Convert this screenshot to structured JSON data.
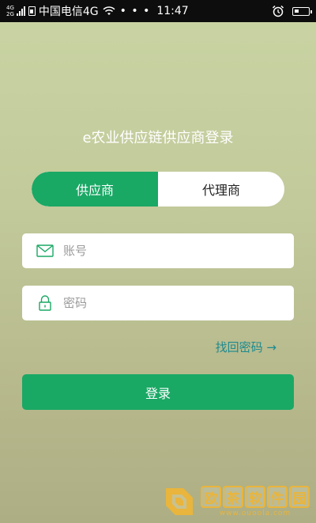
{
  "status_bar": {
    "sig_top": "4G",
    "sig_bottom": "2G",
    "carrier": "中国电信4G",
    "dots": "• • •",
    "time": "11:47"
  },
  "login": {
    "title": "e农业供应链供应商登录",
    "tabs": [
      {
        "label": "供应商",
        "active": true
      },
      {
        "label": "代理商",
        "active": false
      }
    ],
    "account_placeholder": "账号",
    "password_placeholder": "密码",
    "forgot_password": "找回密码 →",
    "submit_label": "登录"
  },
  "watermark": {
    "chars": [
      "欧",
      "茶",
      "软",
      "件",
      "园"
    ],
    "url": "www.ouoola.com"
  },
  "colors": {
    "accent": "#1aa865",
    "link": "#1d8a8f",
    "watermark": "#e9b53c"
  }
}
